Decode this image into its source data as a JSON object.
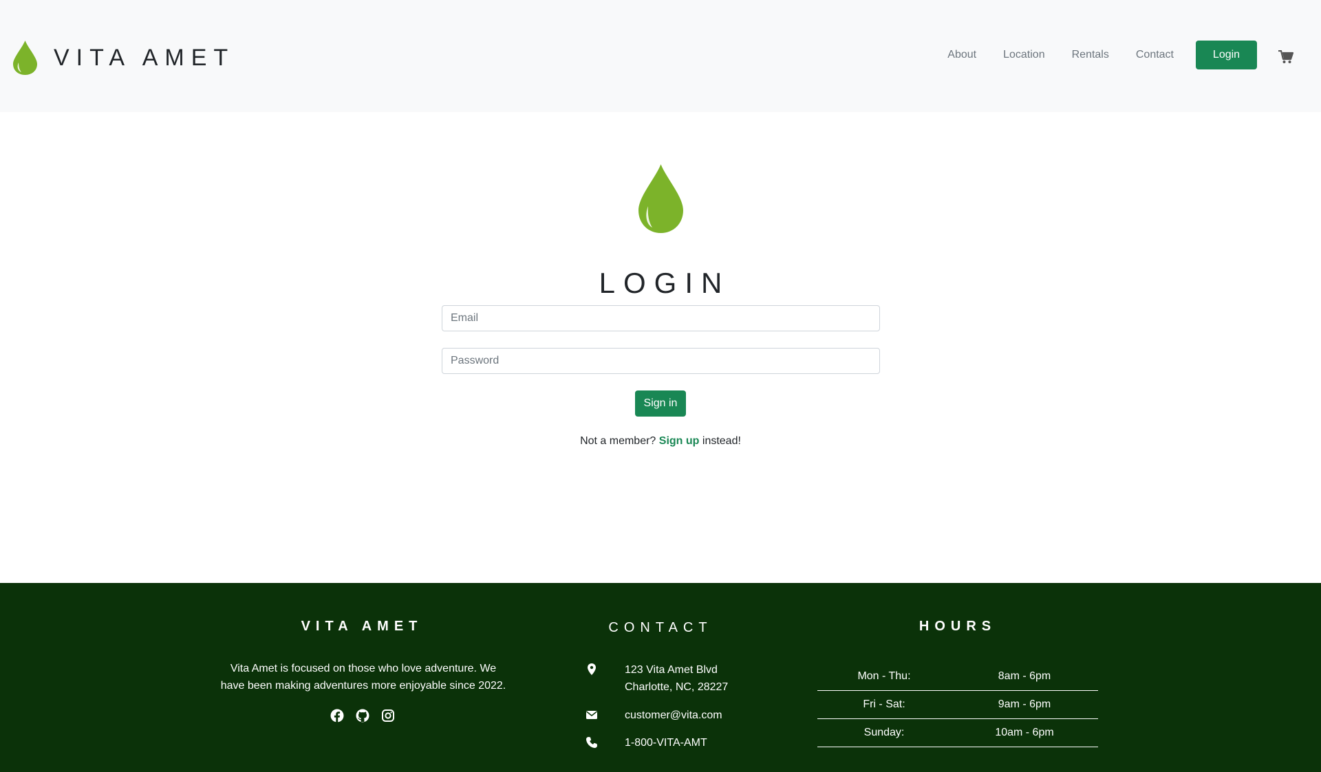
{
  "header": {
    "brand_name": "VITA AMET",
    "nav": [
      {
        "label": "About"
      },
      {
        "label": "Location"
      },
      {
        "label": "Rentals"
      },
      {
        "label": "Contact"
      }
    ],
    "login_label": "Login",
    "cart_icon": "cart-icon"
  },
  "main": {
    "logo_icon": "droplet-icon",
    "title": "LOGIN",
    "email_placeholder": "Email",
    "password_placeholder": "Password",
    "signin_label": "Sign in",
    "member_prefix": "Not a member? ",
    "signup_link": "Sign up",
    "member_suffix": " instead!"
  },
  "footer": {
    "brand_title": "VITA AMET",
    "about_text": "Vita Amet is focused on those who love adventure. We have been making adventures more enjoyable since 2022.",
    "socials": [
      "facebook-icon",
      "github-icon",
      "instagram-icon"
    ],
    "contact_title": "CONTACT",
    "address_line1": "123 Vita Amet Blvd",
    "address_line2": "Charlotte, NC, 28227",
    "email": "customer@vita.com",
    "phone": "1-800-VITA-AMT",
    "hours_title": "HOURS",
    "hours": [
      {
        "day": "Mon - Thu:",
        "time": "8am - 6pm"
      },
      {
        "day": "Fri - Sat:",
        "time": "9am - 6pm"
      },
      {
        "day": "Sunday:",
        "time": "10am - 6pm"
      }
    ]
  },
  "colors": {
    "brand_green": "#7cb32a",
    "button_green": "#198754",
    "footer_bg": "#0b3209"
  }
}
